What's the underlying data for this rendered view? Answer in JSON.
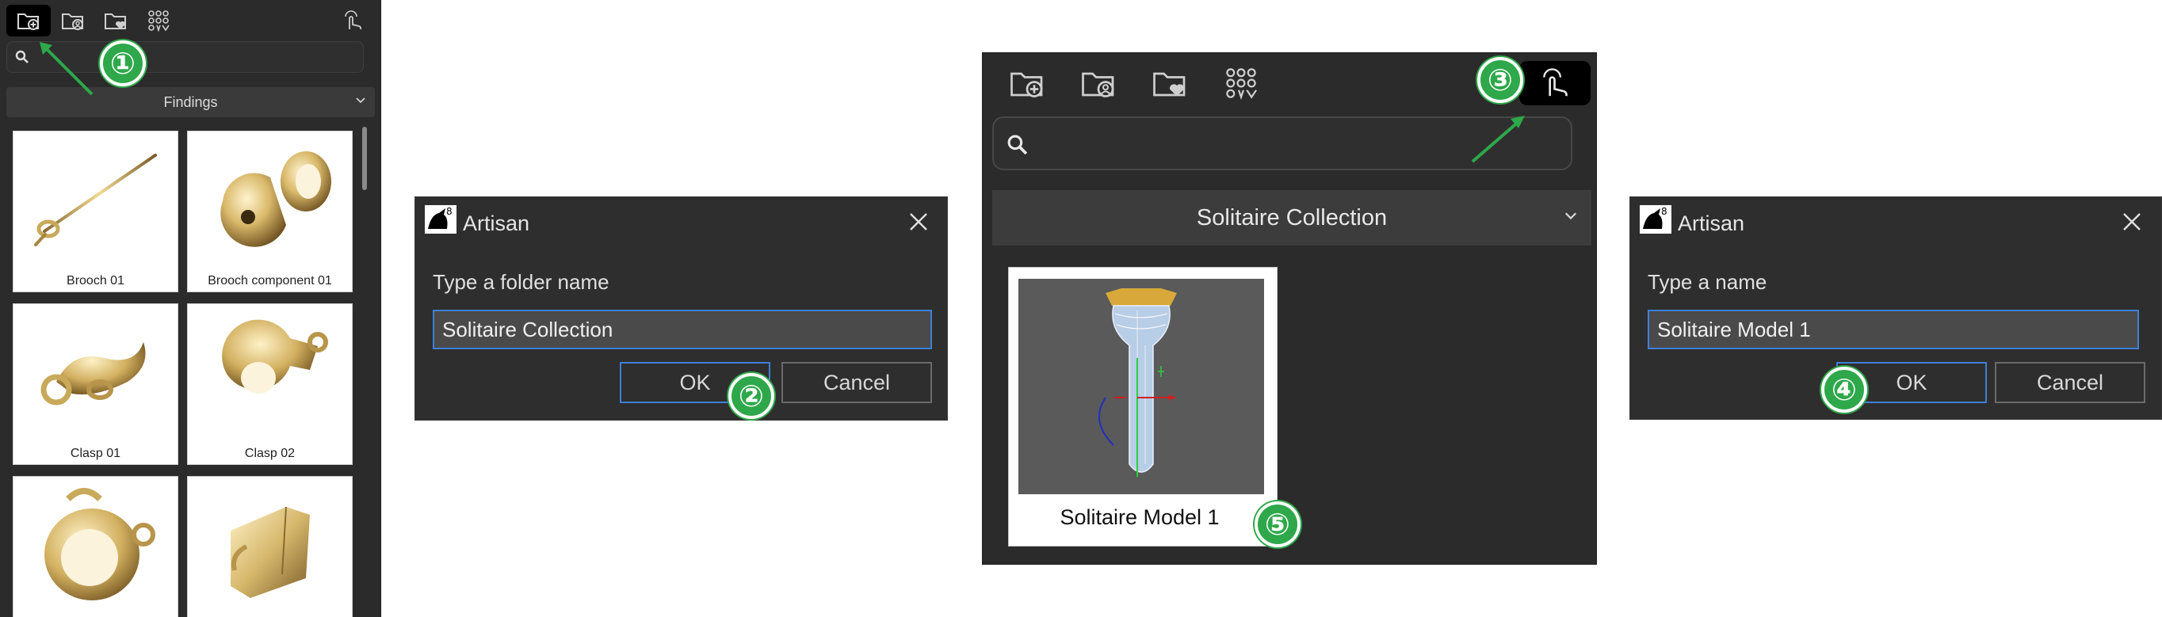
{
  "panel1": {
    "dropdown_value": "Findings",
    "items": [
      {
        "label": "Brooch 01"
      },
      {
        "label": "Brooch component 01"
      },
      {
        "label": "Clasp 01"
      },
      {
        "label": "Clasp 02"
      },
      {
        "label": ""
      },
      {
        "label": ""
      }
    ]
  },
  "dialog_folder": {
    "title": "Artisan",
    "prompt": "Type a folder name",
    "value": "Solitaire Collection",
    "ok_label": "OK",
    "cancel_label": "Cancel"
  },
  "panel3": {
    "dropdown_value": "Solitaire Collection",
    "card_label": "Solitaire Model 1"
  },
  "dialog_name": {
    "title": "Artisan",
    "prompt": "Type a name",
    "value": "Solitaire Model 1",
    "ok_label": "OK",
    "cancel_label": "Cancel"
  },
  "badges": [
    "①",
    "②",
    "③",
    "④",
    "⑤"
  ],
  "colors": {
    "panel_bg": "#2b2b2b",
    "accent_blue": "#3f7fd6",
    "badge_green": "#2ea84a",
    "gold": "#c9a95a"
  },
  "icons": {
    "toolbar": [
      "add-folder-icon",
      "user-folder-icon",
      "favorite-folder-icon",
      "grid-library-icon",
      "touch-mode-icon"
    ],
    "search": "search-icon",
    "dropdown": "chevron-down-icon",
    "close": "close-icon",
    "logo": "rhino-logo-icon"
  }
}
